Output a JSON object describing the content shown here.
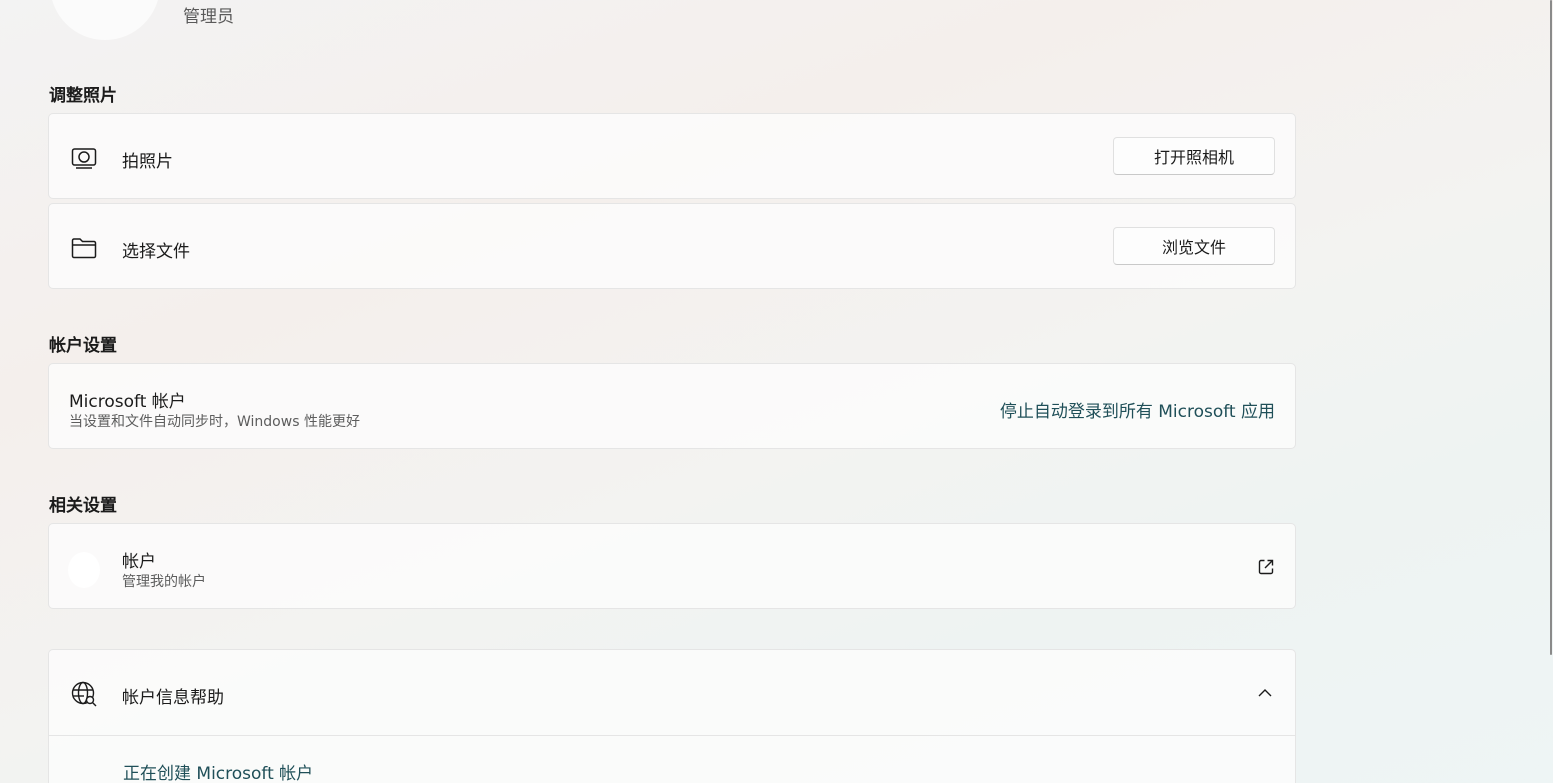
{
  "header": {
    "role": "管理员"
  },
  "photo_section": {
    "title": "调整照片",
    "take_photo": {
      "icon": "camera-icon",
      "label": "拍照片",
      "button": "打开照相机"
    },
    "choose_file": {
      "icon": "folder-icon",
      "label": "选择文件",
      "button": "浏览文件"
    }
  },
  "account_section": {
    "title": "帐户设置",
    "microsoft_account": {
      "label": "Microsoft 帐户",
      "description": "当设置和文件自动同步时，Windows 性能更好",
      "link": "停止自动登录到所有 Microsoft 应用"
    }
  },
  "related_section": {
    "title": "相关设置",
    "accounts": {
      "label": "帐户",
      "description": "管理我的帐户",
      "icon": "external-link-icon"
    }
  },
  "help_section": {
    "icon": "globe-search-icon",
    "label": "帐户信息帮助",
    "expand_icon": "chevron-up-icon",
    "link": "正在创建 Microsoft 帐户"
  },
  "colors": {
    "link": "#1f4f58",
    "card_background": "#fbfbfb"
  }
}
